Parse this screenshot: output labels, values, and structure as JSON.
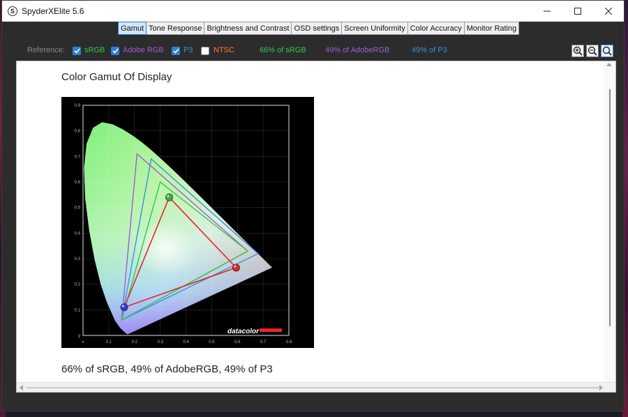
{
  "app": {
    "title": "SpyderXElite 5.6",
    "icon_letter": "S"
  },
  "tabs": [
    {
      "label": "Gamut",
      "active": true
    },
    {
      "label": "Tone Response"
    },
    {
      "label": "Brightness and Contrast"
    },
    {
      "label": "OSD settings"
    },
    {
      "label": "Screen Uniformity"
    },
    {
      "label": "Color Accuracy"
    },
    {
      "label": "Monitor Rating"
    }
  ],
  "reference": {
    "label": "Reference:",
    "options": [
      {
        "label": "sRGB",
        "checked": true,
        "color": "#2ecc40"
      },
      {
        "label": "Adobe RGB",
        "checked": true,
        "color": "#a15ad8"
      },
      {
        "label": "P3",
        "checked": true,
        "color": "#3a8fe0"
      },
      {
        "label": "NTSC",
        "checked": false,
        "color": "#ff7a2a"
      }
    ],
    "stats": [
      {
        "text": "66% of sRGB",
        "color": "#2ecc40"
      },
      {
        "text": "49% of AdobeRGB",
        "color": "#a15ad8"
      },
      {
        "text": "49% of P3",
        "color": "#3a8fe0"
      }
    ]
  },
  "zoom": {
    "zoom_in": "zoom-in-icon",
    "zoom_out": "zoom-out-icon",
    "zoom_fit": "zoom-fit-icon"
  },
  "content": {
    "title": "Color Gamut Of Display",
    "summary": "66% of sRGB, 49% of AdobeRGB, 49% of P3"
  },
  "chart_data": {
    "type": "scatter",
    "title": "",
    "xlabel": "x",
    "ylabel": "y",
    "xlim": [
      0,
      0.8
    ],
    "ylim": [
      0,
      0.9
    ],
    "x_ticks": [
      "x",
      "0.1",
      "0.2",
      "0.3",
      "0.4",
      "0.5",
      "0.6",
      "0.7",
      "0.8"
    ],
    "y_ticks": [
      "y",
      "0.1",
      "0.2",
      "0.3",
      "0.4",
      "0.5",
      "0.6",
      "0.7",
      "0.8",
      "0.9"
    ],
    "grid": true,
    "watermark": "datacolor",
    "series": [
      {
        "name": "Adobe RGB",
        "color": "#a15ad8",
        "x": [
          0.64,
          0.21,
          0.15
        ],
        "y": [
          0.33,
          0.71,
          0.06
        ]
      },
      {
        "name": "P3",
        "color": "#3a8fe0",
        "x": [
          0.68,
          0.265,
          0.15
        ],
        "y": [
          0.32,
          0.69,
          0.06
        ]
      },
      {
        "name": "sRGB",
        "color": "#2ecc40",
        "x": [
          0.64,
          0.3,
          0.15
        ],
        "y": [
          0.33,
          0.6,
          0.06
        ]
      },
      {
        "name": "Display",
        "color": "#e8252a",
        "x": [
          0.595,
          0.335,
          0.16
        ],
        "y": [
          0.265,
          0.54,
          0.11
        ]
      }
    ]
  }
}
